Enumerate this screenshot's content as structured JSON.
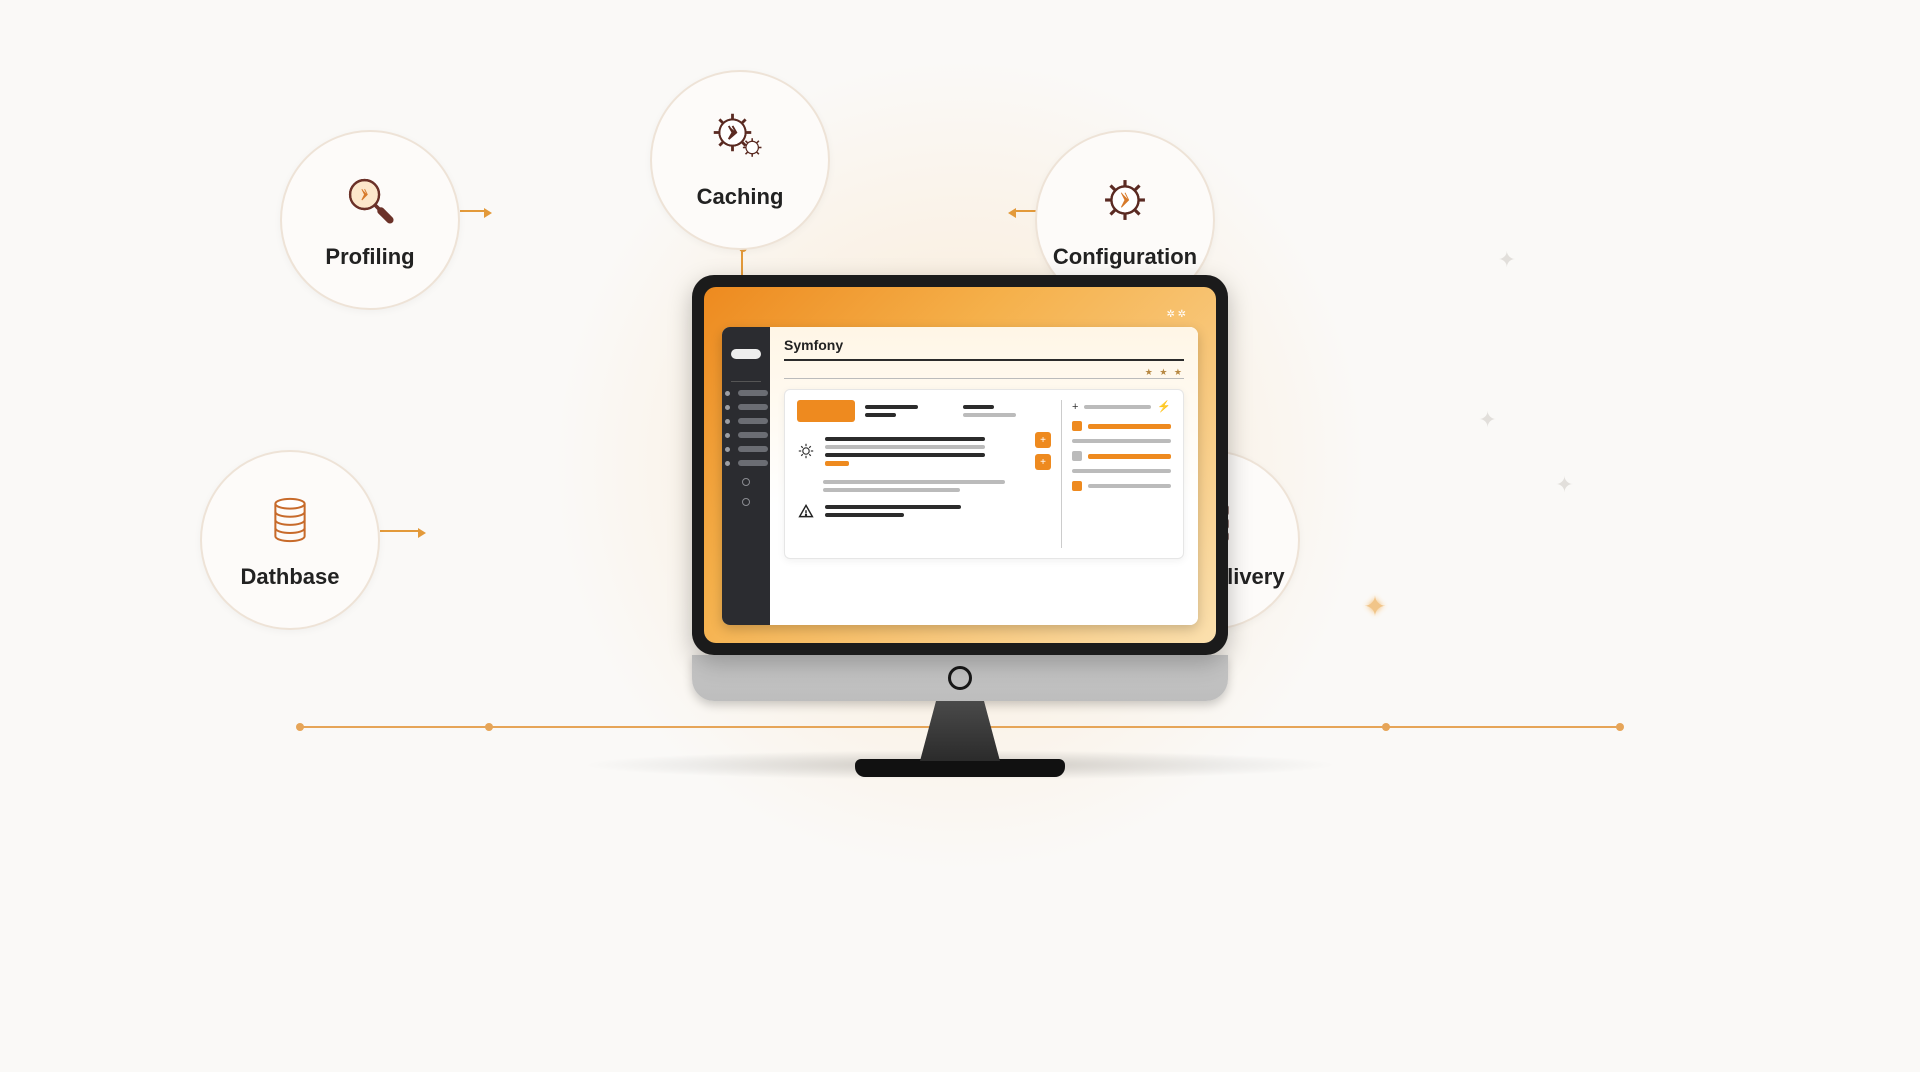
{
  "bubbles": {
    "profiling": "Profiling",
    "caching": "Caching",
    "configuration": "Configuration",
    "database": "Dathbase",
    "asset": "Asset delivery"
  },
  "app": {
    "title": "Symfony"
  }
}
